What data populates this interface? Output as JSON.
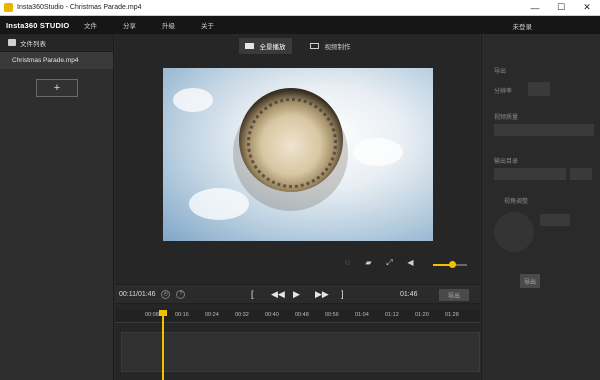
{
  "window": {
    "title": "Insta360Studio - Christmas Parade.mp4",
    "controls": {
      "minimize": "—",
      "maximize": "☐",
      "close": "✕"
    }
  },
  "menubar": {
    "brand": "Insta360 STUDIO",
    "items": [
      "文件",
      "分享",
      "升级",
      "关于"
    ],
    "login": "未登录"
  },
  "sidebar": {
    "header": "文件列表",
    "files": [
      "Christmas Parade.mp4"
    ],
    "add_button": "+"
  },
  "center": {
    "tabs": [
      {
        "label": "全景播放",
        "active": true
      },
      {
        "label": "视频制作",
        "active": false
      }
    ],
    "volume_level": 0.55
  },
  "transport": {
    "current": "00:11/01:46",
    "duration": "01:46",
    "prev": "◀◀",
    "play": "▶",
    "next": "▶▶",
    "bracket_left": "[",
    "bracket_right": "]",
    "export_label": "导出"
  },
  "timeline": {
    "ticks": [
      "00:08",
      "00:16",
      "00:24",
      "00:32",
      "00:40",
      "00:48",
      "00:56",
      "01:04",
      "01:12",
      "01:20",
      "01:28"
    ]
  },
  "right_panel": {
    "labels": {
      "section": "导出",
      "a": "分辨率",
      "b": "视频质量",
      "c": "输出目录",
      "d": "视角调整"
    }
  },
  "colors": {
    "accent": "#f2c200",
    "bg_dark": "#262626",
    "menubar": "#161616"
  }
}
